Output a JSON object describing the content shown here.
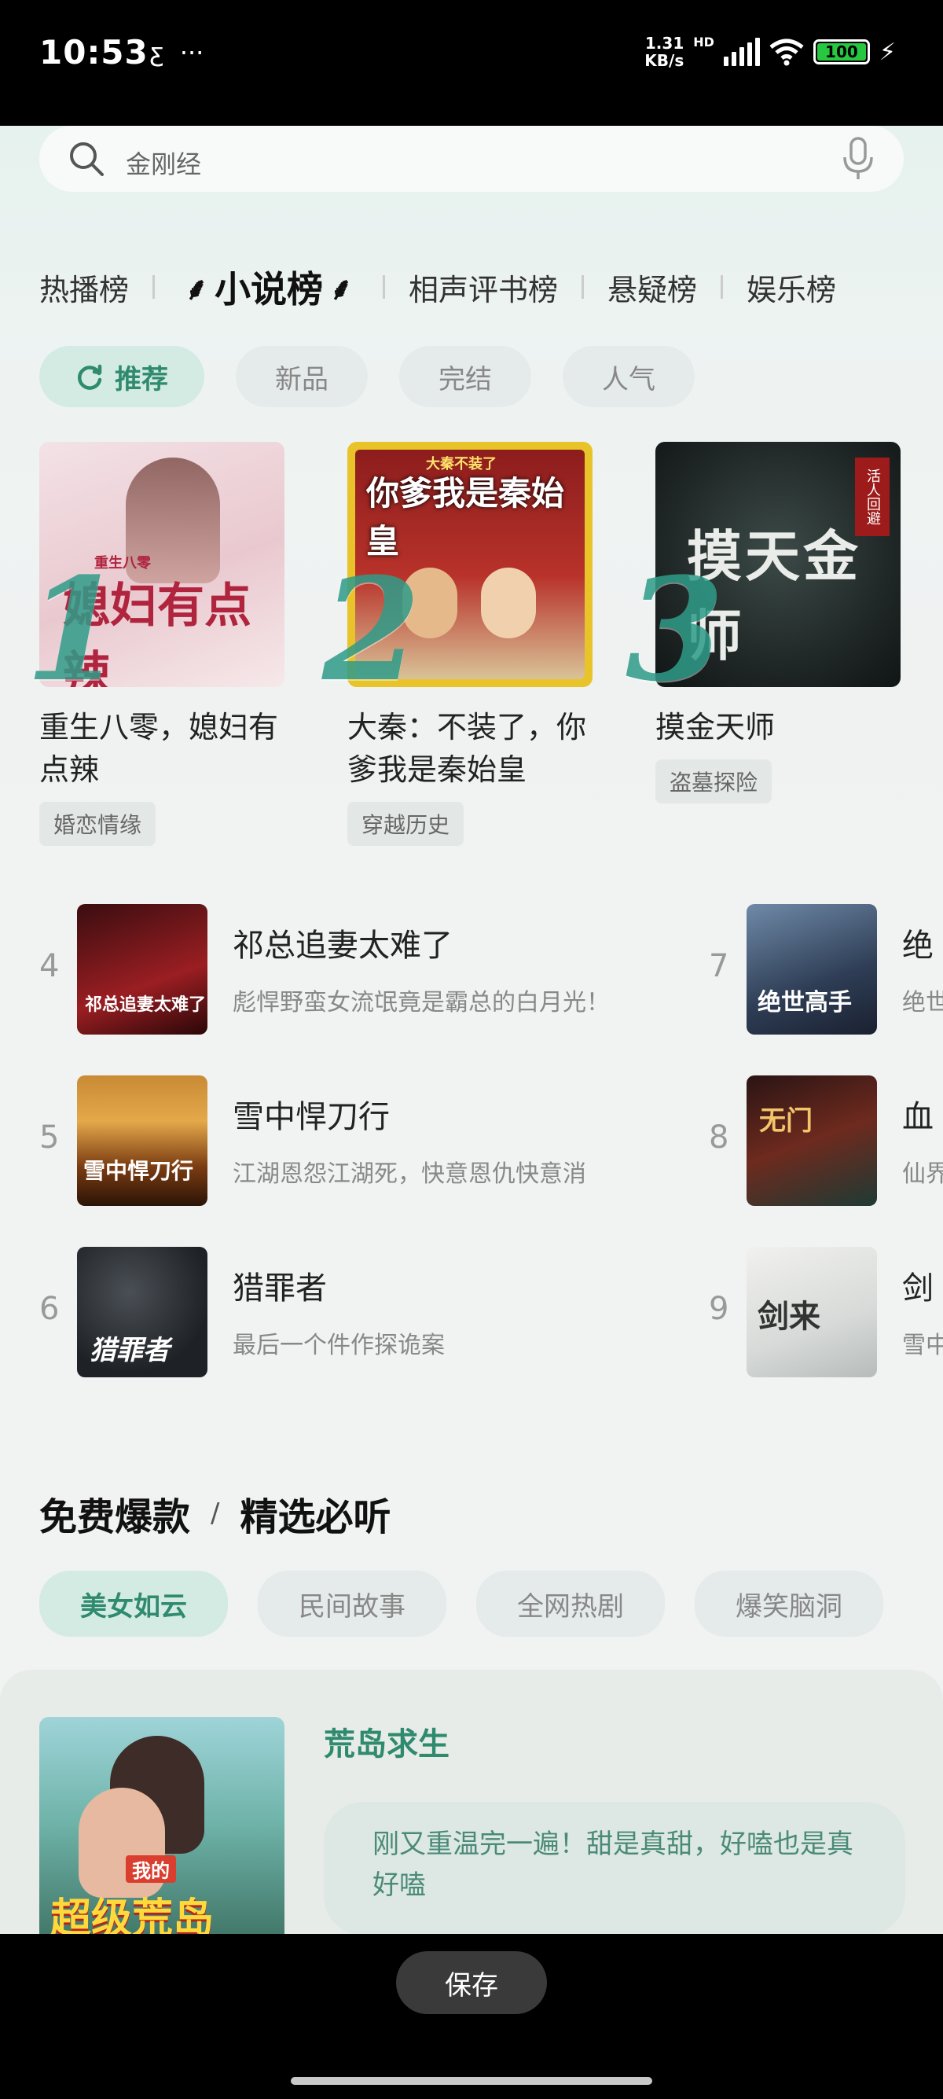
{
  "status": {
    "time": "10:53",
    "net_speed_value": "1.31",
    "net_speed_unit": "KB/s",
    "network_type": "HD",
    "battery": "100"
  },
  "search": {
    "placeholder": "金刚经"
  },
  "rank_tabs": [
    "热播榜",
    "小说榜",
    "相声评书榜",
    "悬疑榜",
    "娱乐榜"
  ],
  "active_rank_tab": "小说榜",
  "filters": [
    "推荐",
    "新品",
    "完结",
    "人气"
  ],
  "active_filter": "推荐",
  "top3": [
    {
      "rank": "1",
      "title": "重生八零，媳妇有点辣",
      "tag": "婚恋情缘",
      "cover_text": "媳妇有点辣",
      "cover_small": "重生八零"
    },
    {
      "rank": "2",
      "title": "大秦：不装了，你爹我是秦始皇",
      "tag": "穿越历史",
      "cover_text": "你爹我是秦始皇",
      "cover_small": "大秦不装了"
    },
    {
      "rank": "3",
      "title": "摸金天师",
      "tag": "盗墓探险",
      "cover_text": "摸天金师",
      "cover_small": "活人回避"
    }
  ],
  "ranked": [
    {
      "rank": "4",
      "title": "祁总追妻太难了",
      "desc": "彪悍野蛮女流氓竟是霸总的白月光！",
      "cover_text": "祁总追妻太难了"
    },
    {
      "rank": "5",
      "title": "雪中悍刀行",
      "desc": "江湖恩怨江湖死，快意恩仇快意消",
      "cover_text": "雪中悍刀行"
    },
    {
      "rank": "6",
      "title": "猎罪者",
      "desc": "最后一个件作探诡案",
      "cover_text": "猎罪者"
    },
    {
      "rank": "7",
      "title": "绝",
      "desc": "绝世",
      "cover_text": "绝世高手"
    },
    {
      "rank": "8",
      "title": "血",
      "desc": "仙界",
      "cover_text": "无门"
    },
    {
      "rank": "9",
      "title": "剑",
      "desc": "雪中",
      "cover_text": "剑来"
    }
  ],
  "section": {
    "title1": "免费爆款",
    "slash": "/",
    "title2": "精选必听"
  },
  "section_chips": [
    "美女如云",
    "民间故事",
    "全网热剧",
    "爆笑脑洞"
  ],
  "active_section_chip": "美女如云",
  "feature": {
    "title": "荒岛求生",
    "quote": "刚又重温完一遍！甜是真甜，好嗑也是真好嗑",
    "cover_text": "超级荒岛",
    "cover_small": "我的"
  },
  "bottom": {
    "save_label": "保存"
  },
  "colors": {
    "accent": "#2f8a6e",
    "rank_number": "#2f9c89"
  }
}
